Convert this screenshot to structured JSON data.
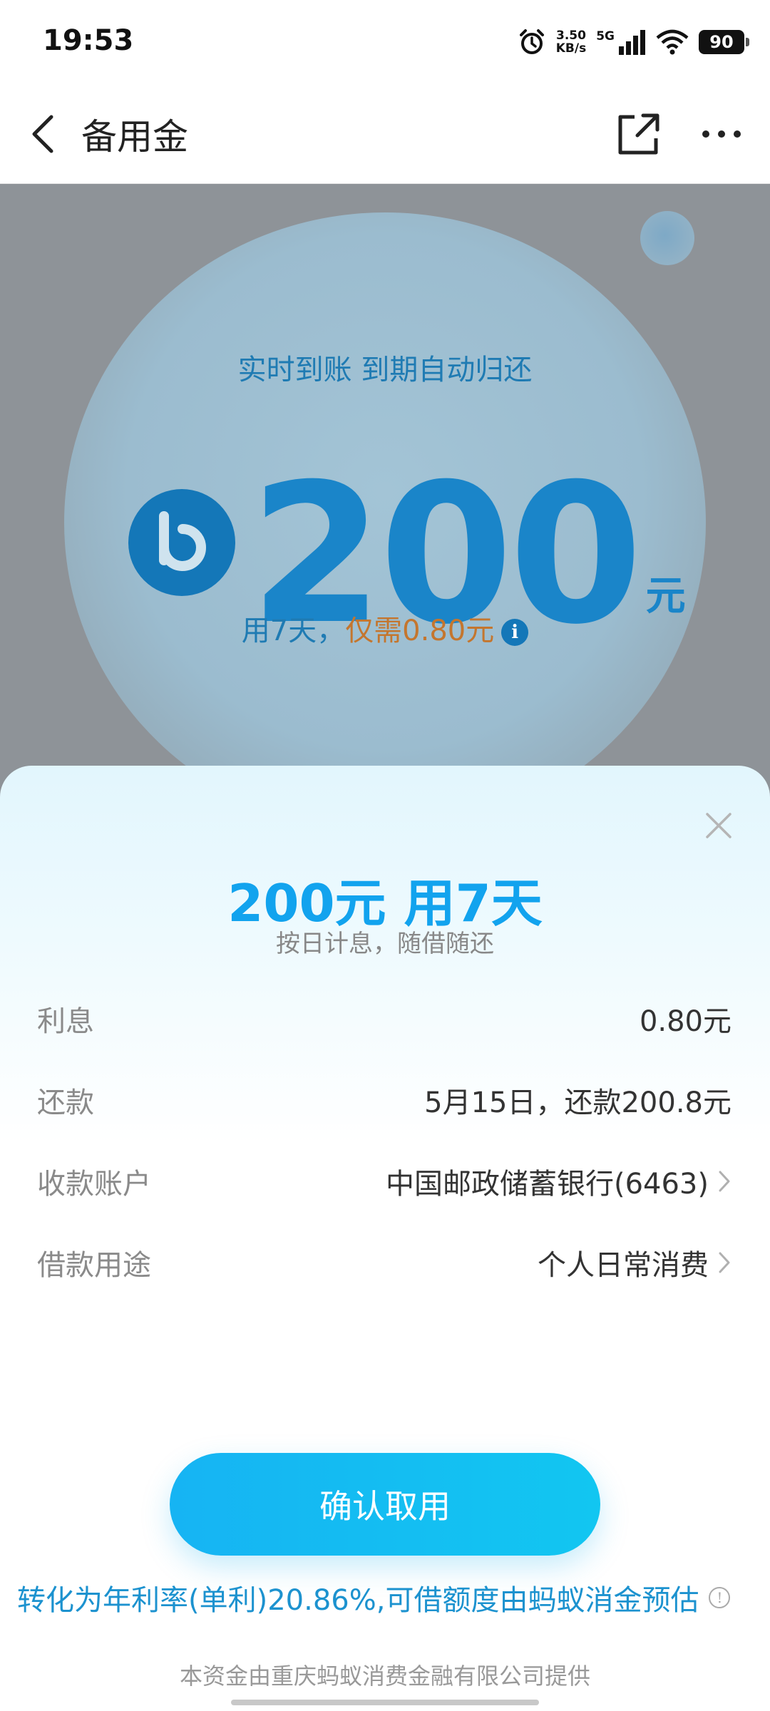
{
  "status_bar": {
    "time": "19:53",
    "net_speed_value": "3.50",
    "net_speed_unit": "KB/s",
    "network": "5G",
    "battery": "90"
  },
  "nav": {
    "title": "备用金"
  },
  "background": {
    "tagline": "实时到账 到期自动归还",
    "amount": "200",
    "unit": "元",
    "sub_prefix": "用7天，",
    "sub_cost": "仅需0.80元",
    "info_glyph": "i"
  },
  "sheet": {
    "title": "200元 用7天",
    "subtitle": "按日计息，随借随还",
    "rows": [
      {
        "label": "利息",
        "value": "0.80元"
      },
      {
        "label": "还款",
        "value": "5月15日，还款200.8元"
      },
      {
        "label": "收款账户",
        "value": "中国邮政储蓄银行(6463)"
      },
      {
        "label": "借款用途",
        "value": "个人日常消费"
      }
    ],
    "confirm_label": "确认取用",
    "rate_note": "转化为年利率(单利)20.86%,可借额度由蚂蚁消金预估",
    "rate_info_glyph": "!",
    "provider": "本资金由重庆蚂蚁消费金融有限公司提供"
  },
  "colors": {
    "accent": "#12a3ee",
    "button": "#16b4f3",
    "cost_orange": "#c4762e",
    "overlay": "#8e9398"
  }
}
